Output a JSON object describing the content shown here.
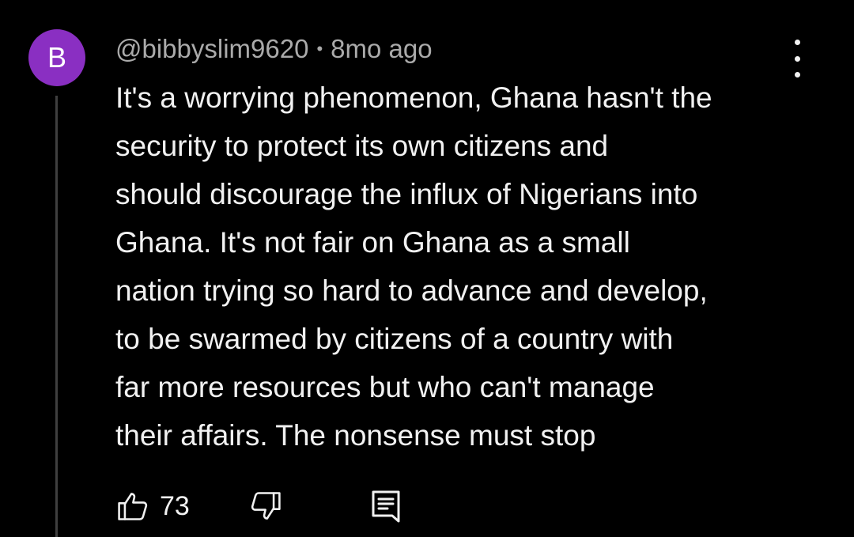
{
  "comment": {
    "avatar_initial": "B",
    "avatar_color": "#8a2fc2",
    "author": "@bibbyslim9620",
    "separator": "•",
    "timestamp": "8mo ago",
    "text_lines": [
      "It's a worrying phenomenon, Ghana hasn't the",
      "security to protect its own citizens and",
      "should discourage the influx of Nigerians into",
      "Ghana. It's not fair on Ghana as a small",
      "nation trying so hard to advance and develop,",
      "to be swarmed by citizens of a country with",
      "far more resources but who can't manage",
      "their affairs. The nonsense must stop"
    ],
    "like_count": "73"
  },
  "icons": {
    "like": "thumbs-up-icon",
    "dislike": "thumbs-down-icon",
    "reply": "reply-comment-icon",
    "more": "vertical-ellipsis-icon"
  }
}
